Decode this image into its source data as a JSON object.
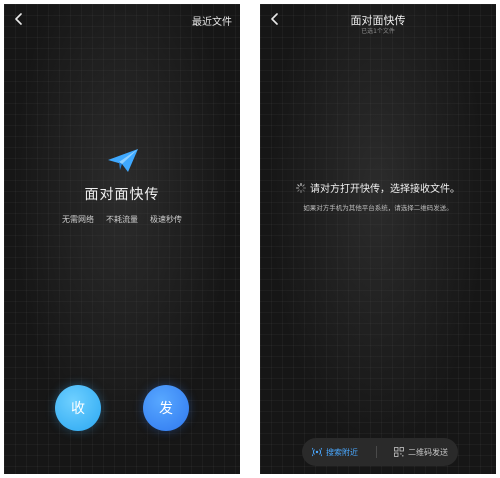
{
  "left_screen": {
    "header": {
      "recent_files_label": "最近文件"
    },
    "feature": {
      "title": "面对面快传",
      "tags": [
        "无需网络",
        "不耗流量",
        "极速秒传"
      ]
    },
    "actions": {
      "receive_label": "收",
      "send_label": "发"
    }
  },
  "right_screen": {
    "header": {
      "title": "面对面快传",
      "subtitle": "已选1个文件"
    },
    "status": {
      "message": "请对方打开快传，选择接收文件。"
    },
    "hint": "如果对方手机为其他平台系统，请选择二维码发送。",
    "bottom_bar": {
      "search_nearby_label": "搜索附近",
      "qr_send_label": "二维码发送"
    }
  },
  "colors": {
    "accent_blue": "#4aa8ff",
    "receive_button": "#2aa7f2",
    "send_button": "#2f78f0",
    "background": "#161616"
  },
  "icons": [
    "back-arrow-icon",
    "paper-plane-icon",
    "loading-spinner-icon",
    "wifi-signal-icon",
    "qr-code-icon"
  ]
}
